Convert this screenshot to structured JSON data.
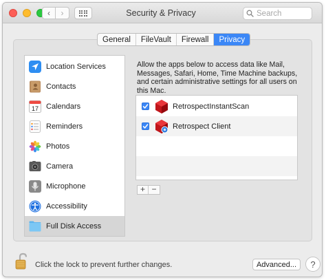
{
  "window": {
    "title": "Security & Privacy",
    "search_placeholder": "Search"
  },
  "tabs": [
    {
      "label": "General",
      "active": false
    },
    {
      "label": "FileVault",
      "active": false
    },
    {
      "label": "Firewall",
      "active": false
    },
    {
      "label": "Privacy",
      "active": true
    }
  ],
  "sidebar": {
    "items": [
      {
        "label": "Location Services",
        "icon": "location-arrow-icon"
      },
      {
        "label": "Contacts",
        "icon": "contacts-book-icon"
      },
      {
        "label": "Calendars",
        "icon": "calendar-icon",
        "day": "17"
      },
      {
        "label": "Reminders",
        "icon": "reminders-list-icon"
      },
      {
        "label": "Photos",
        "icon": "photos-flower-icon"
      },
      {
        "label": "Camera",
        "icon": "camera-icon"
      },
      {
        "label": "Microphone",
        "icon": "microphone-icon"
      },
      {
        "label": "Accessibility",
        "icon": "accessibility-icon"
      },
      {
        "label": "Full Disk Access",
        "icon": "folder-icon",
        "selected": true
      }
    ]
  },
  "description": "Allow the apps below to access data like Mail, Messages, Safari, Home, Time Machine backups, and certain administrative settings for all users on this Mac.",
  "apps": [
    {
      "name": "RetrospectInstantScan",
      "checked": true,
      "icon": "retrospect-cube-icon"
    },
    {
      "name": "Retrospect Client",
      "checked": true,
      "icon": "retrospect-client-icon"
    }
  ],
  "list_controls": {
    "add": "+",
    "remove": "−"
  },
  "footer": {
    "lock_text": "Click the lock to prevent further changes.",
    "advanced_label": "Advanced...",
    "help_label": "?"
  },
  "colors": {
    "accent": "#3b87f6",
    "close": "#fd5f57",
    "minimize": "#febc2e",
    "maximize": "#2bc840"
  }
}
